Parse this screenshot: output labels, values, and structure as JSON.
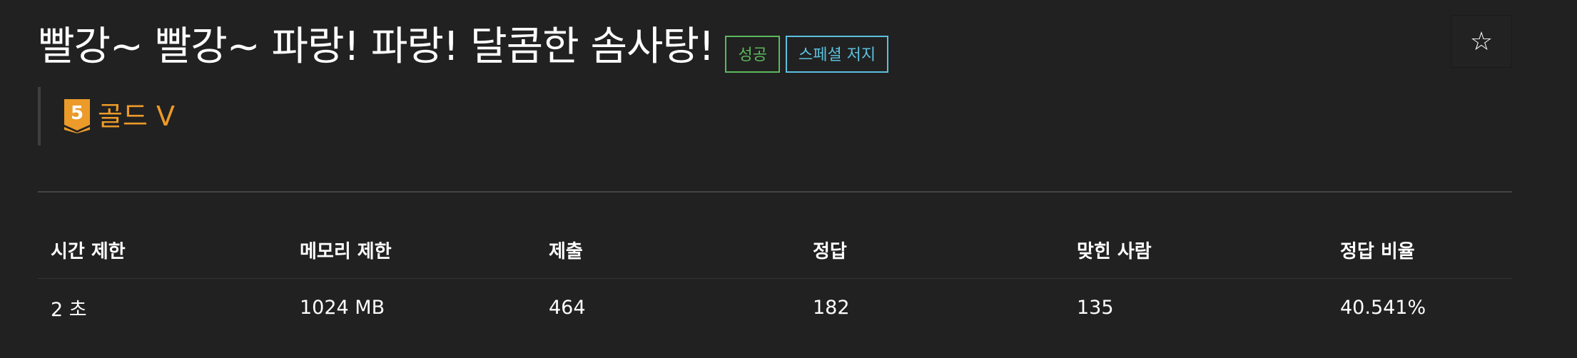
{
  "problem": {
    "title": "빨강~ 빨강~ 파랑! 파랑! 달콤한 솜사탕!",
    "labels": {
      "success": "성공",
      "special_judge": "스페셜 저지"
    },
    "star_icon": "☆",
    "tier": {
      "badge_number": "5",
      "name": "골드 V",
      "color": "#ec9a29"
    }
  },
  "stats": {
    "headers": [
      "시간 제한",
      "메모리 제한",
      "제출",
      "정답",
      "맞힌 사람",
      "정답 비율"
    ],
    "values": [
      "2 초",
      "1024 MB",
      "464",
      "182",
      "135",
      "40.541%"
    ]
  },
  "colors": {
    "background": "#212121",
    "success": "#5cb85c",
    "special_judge": "#5bc0de",
    "gold_tier": "#ec9a29"
  }
}
